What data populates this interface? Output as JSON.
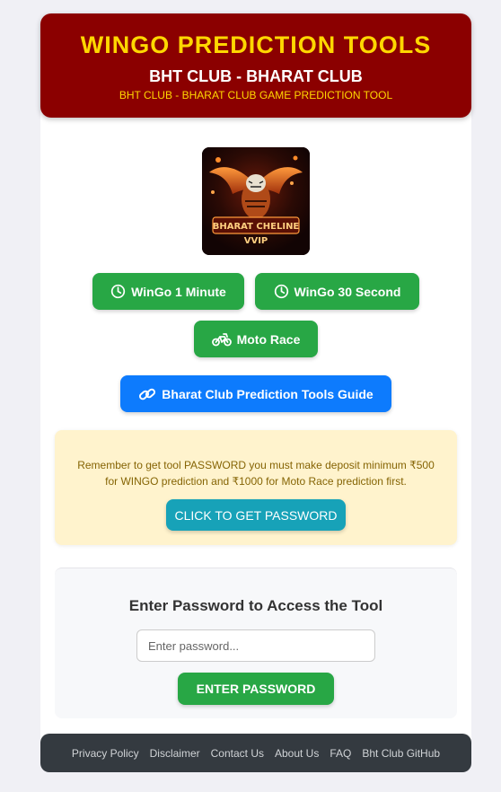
{
  "header": {
    "title": "WINGO PREDICTION TOOLS",
    "subtitle": "BHT CLUB - BHARAT CLUB",
    "tagline": "BHT CLUB - BHARAT CLUB GAME PREDICTION TOOL"
  },
  "logo": {
    "line1": "BHARAT CHELINE",
    "line2": "VVIP"
  },
  "games": [
    {
      "label": "WinGo 1 Minute",
      "icon": "clock-icon"
    },
    {
      "label": "WinGo 30 Second",
      "icon": "clock-icon"
    },
    {
      "label": "Moto Race",
      "icon": "motorcycle-icon"
    }
  ],
  "guide": {
    "label": "Bharat Club Prediction Tools Guide",
    "icon": "link-icon"
  },
  "notice": {
    "text": "Remember to get tool PASSWORD you must make deposit minimum ₹500 for WINGO prediction and ₹1000 for Moto Race prediction first.",
    "button": "CLICK TO GET PASSWORD"
  },
  "password": {
    "heading": "Enter Password to Access the Tool",
    "placeholder": "Enter password...",
    "value": "",
    "button": "ENTER PASSWORD"
  },
  "footer": {
    "links": [
      "Privacy Policy",
      "Disclaimer",
      "Contact Us",
      "About Us",
      "FAQ",
      "Bht Club GitHub"
    ]
  },
  "colors": {
    "header_bg": "#8b0000",
    "header_title": "#ffd700",
    "green": "#28a745",
    "blue": "#0d7bfd",
    "teal": "#17a2b8",
    "notice_bg": "#fff3cd",
    "footer_bg": "#343a40"
  }
}
